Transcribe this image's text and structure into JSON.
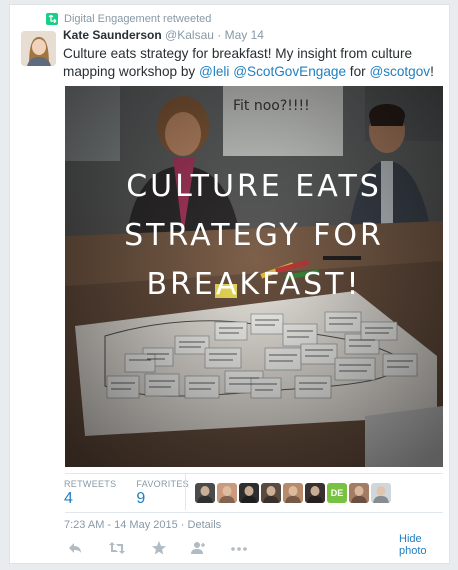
{
  "retweet_bar": {
    "text": "Digital Engagement retweeted"
  },
  "author": {
    "fullname": "Kate Saunderson",
    "handle": "@Kalsau",
    "date": "May 14"
  },
  "tweet": {
    "text_1": "Culture eats strategy for breakfast! My insight from culture mapping workshop by ",
    "mention_1": "@leli",
    "mention_2": "@ScotGovEngage",
    "text_2": " for ",
    "mention_3": "@scotgov",
    "text_3": "!"
  },
  "media": {
    "overlay_line_1": "CULTURE EATS",
    "overlay_line_2": "STRATEGY FOR",
    "overlay_line_3": "BREAKFAST!",
    "handwritten": "Fit noo?!!!!",
    "sticky_notes": [
      "Fear",
      "Moves",
      "Silos",
      "More data than we use",
      "Too large volume of data",
      "Process",
      "Kindly not",
      "Hard to know who to speak to",
      "Change takes too long",
      "Resources not available",
      "Lack of skills",
      "Desire to be seen to do the right thing",
      "Too risky",
      "Siloed work",
      "Strict processes",
      "Different goals",
      "Permitters not always supportive",
      "Moving too slow",
      "Bureaucratic",
      "Good ideas"
    ]
  },
  "stats": {
    "retweets_label": "RETWEETS",
    "retweets_value": "4",
    "favorites_label": "FAVORITES",
    "favorites_value": "9"
  },
  "likers": [
    {
      "name": "liker-1",
      "color": "#4b4b4b"
    },
    {
      "name": "liker-2",
      "color": "#c99a7d"
    },
    {
      "name": "liker-3",
      "color": "#2e2e2e"
    },
    {
      "name": "liker-4",
      "color": "#5a4a40"
    },
    {
      "name": "liker-5",
      "color": "#b78a6a"
    },
    {
      "name": "liker-6",
      "color": "#3a3030"
    },
    {
      "name": "liker-7",
      "color": "#79c143",
      "initials": "DE"
    },
    {
      "name": "liker-8",
      "color": "#a47c64"
    },
    {
      "name": "liker-9",
      "color": "#d0d7dc"
    }
  ],
  "timestamp": "7:23 AM - 14 May 2015 · Details",
  "hide_photo": "Hide photo",
  "colors": {
    "link": "#1f7fbf",
    "muted": "#8899a6",
    "retweet_green": "#19cf86"
  }
}
